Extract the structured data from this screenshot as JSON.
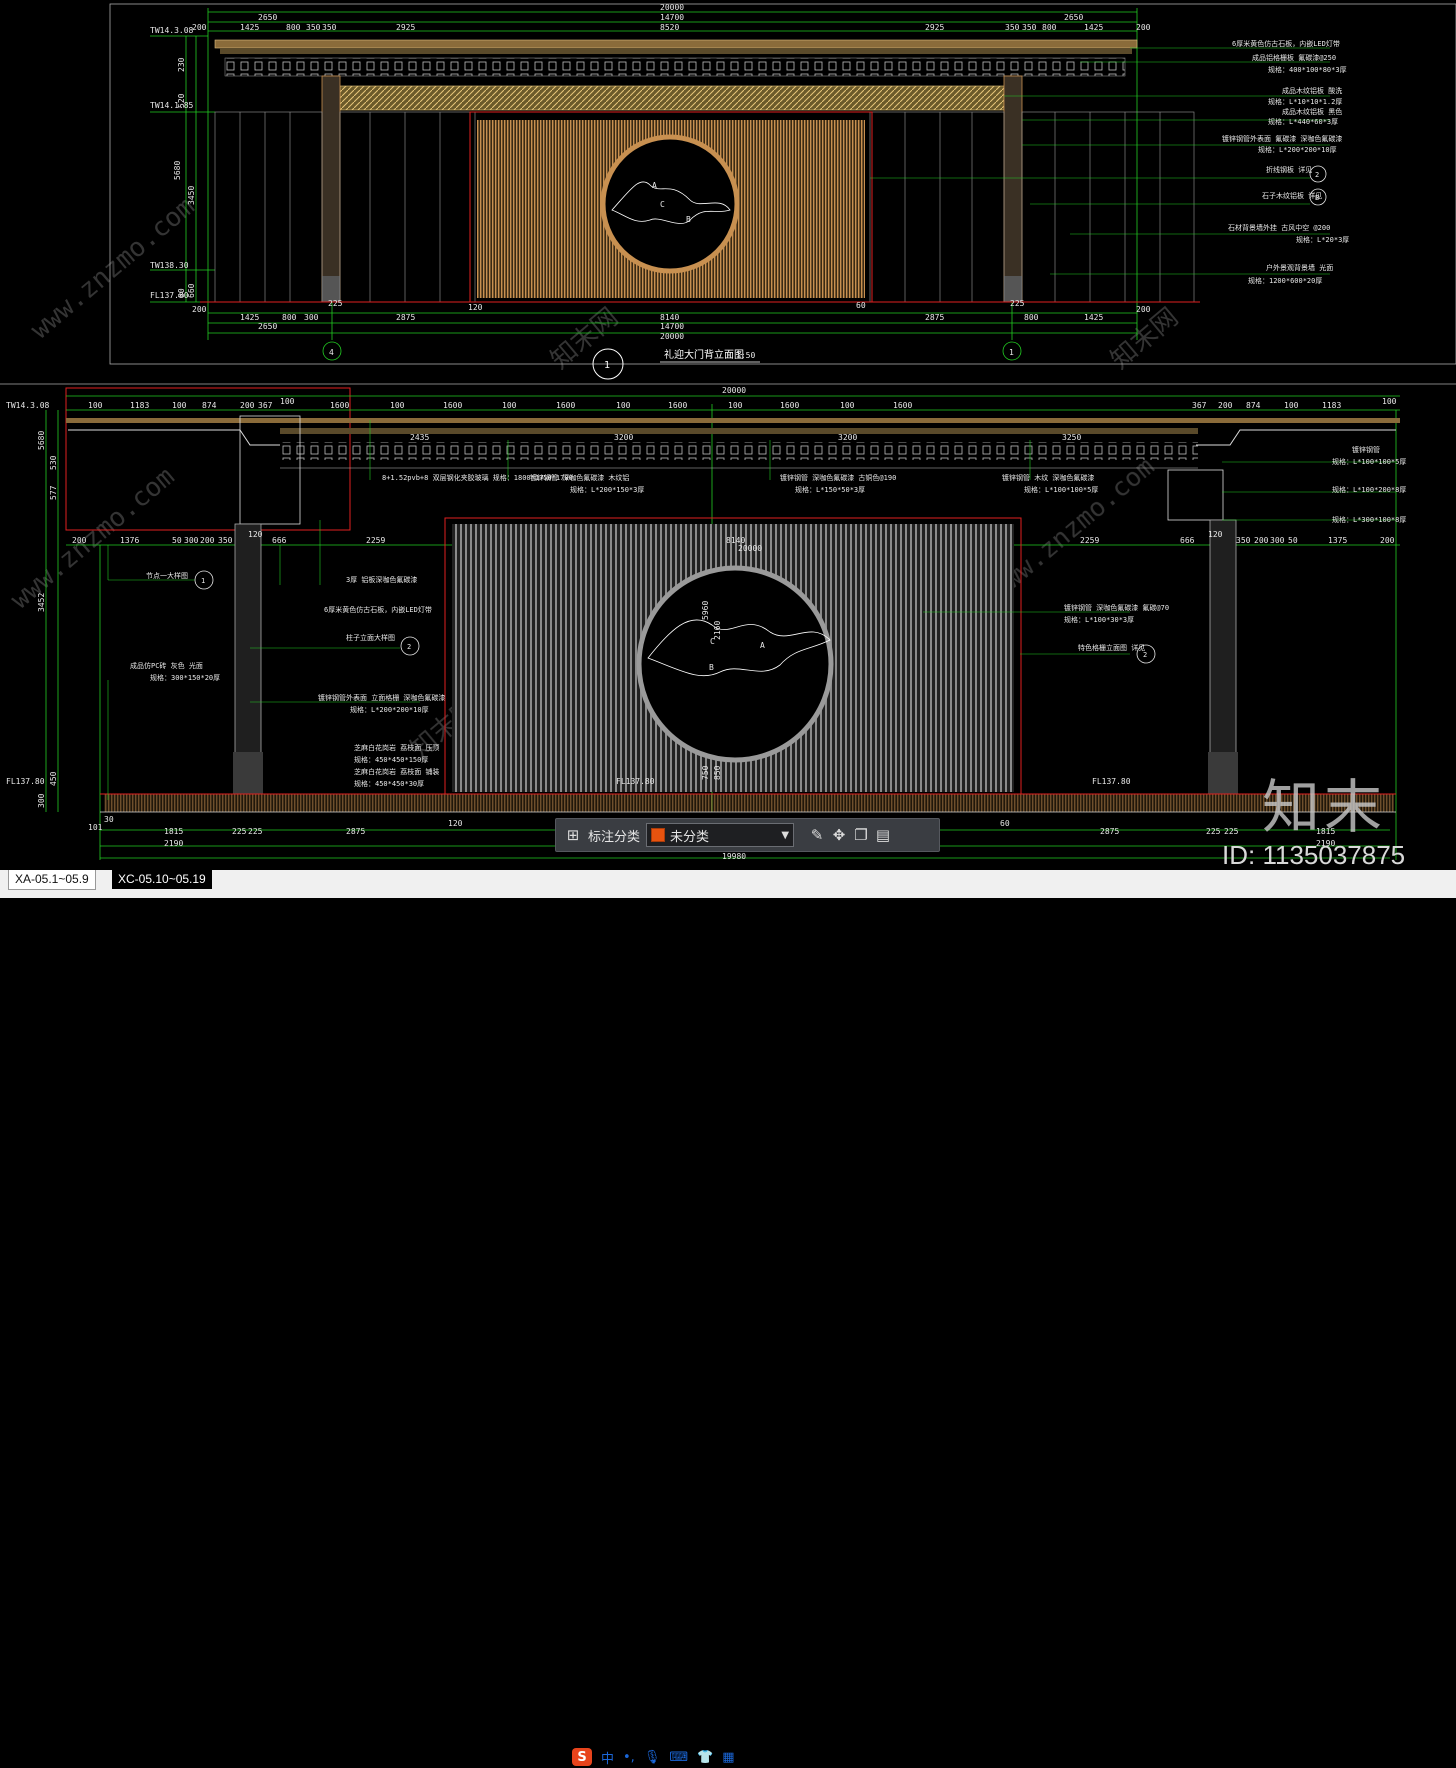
{
  "drawing": {
    "upper_title": "礼迎大门背立面图",
    "upper_scale": "1:50",
    "upper_marker": "1",
    "upper_axis_left": "4",
    "upper_axis_right": "1",
    "upper_dims_top": [
      "20000",
      "14700",
      "2650",
      "1425",
      "800",
      "350",
      "350",
      "2925",
      "8520",
      "2925",
      "350",
      "350",
      "800",
      "1425",
      "2650",
      "200",
      "200"
    ],
    "upper_dims_bottom": [
      "200",
      "1425",
      "800",
      "300",
      "225",
      "2875",
      "120",
      "8140",
      "60",
      "2875",
      "225",
      "800",
      "1425",
      "200",
      "2650",
      "14700",
      "20000"
    ],
    "upper_levels": [
      "TW14.3.08",
      "TW14.1.85",
      "TW138.30",
      "FL137.80"
    ],
    "upper_heights": [
      "230",
      "520",
      "3450",
      "5680",
      "660",
      "80"
    ],
    "upper_notes": [
      "6厚米黄色仿古石板，内嵌LED灯带",
      "成品铝格栅板 氟碳漆@250",
      "规格：400*100*80*3厚",
      "成品木纹铝板 酸洗",
      "规格：L*10*10*1.2厚",
      "成品木纹铝板 黑色",
      "规格：L*440*60*3厚",
      "镀锌钢管外表面 氟碳漆 深咖色氟碳漆",
      "规格：L*200*200*10厚",
      "折线钢板 详见",
      "石子木纹铝板 详见",
      "石材背景墙外挂 古风中空 @200",
      "规格：L*20*3厚",
      "户外景观背景墙 光面",
      "规格：1200*600*20厚"
    ],
    "lower_dims_top": [
      "20000",
      "100",
      "1183",
      "100",
      "874",
      "200",
      "367",
      "100",
      "1600",
      "100",
      "1600",
      "100",
      "1600",
      "100",
      "1600",
      "100",
      "1600",
      "100",
      "1600",
      "367",
      "200",
      "874",
      "100",
      "1183",
      "100"
    ],
    "lower_dims_mid": [
      "200",
      "1376",
      "50",
      "300",
      "200",
      "350",
      "120",
      "666",
      "2259",
      "8140",
      "20000",
      "2259",
      "666",
      "120",
      "350",
      "200",
      "300",
      "50",
      "1375",
      "200"
    ],
    "lower_dims_bottom": [
      "101",
      "30",
      "1815",
      "225",
      "225",
      "2875",
      "120",
      "60",
      "2875",
      "225",
      "225",
      "1815",
      "2190",
      "2190",
      "19980"
    ],
    "lower_dims_beam": [
      "2435",
      "3200",
      "3200",
      "3250"
    ],
    "lower_levels": [
      "TW14.3.08",
      "FL137.80",
      "FL137.80",
      "FL137.80"
    ],
    "lower_heights": [
      "5680",
      "3452",
      "577",
      "530",
      "450",
      "300",
      "2160",
      "5960",
      "750",
      "850"
    ],
    "lower_notes": [
      "8+1.52pvb+8 双层钢化夹胶玻璃 规格：1800*1750*1700",
      "镀锌钢管 深咖色氟碳漆 木纹铝",
      "规格：L*200*150*3厚",
      "镀锌钢管 深咖色氟碳漆 古铜色@190",
      "规格：L*150*50*3厚",
      "镀锌钢管 木纹 深咖色氟碳漆",
      "规格：L*100*100*5厚",
      "镀锌钢管",
      "规格：L*100*100*5厚",
      "规格：L*100*200*8厚",
      "规格：L*300*100*8厚",
      "节点一大样图",
      "3厚 铝板深咖色氟碳漆",
      "6厚米黄色仿古石板，内嵌LED灯带",
      "柱子立面大样图",
      "成品仿PC砖 灰色 光面",
      "规格：300*150*20厚",
      "镀锌钢管外表面 立面格栅 深咖色氟碳漆",
      "规格：L*200*200*10厚",
      "芝麻白花岗岩 荔枝面 压顶",
      "规格：450*450*150厚",
      "芝麻白花岗岩 荔枝面 铺装",
      "规格：450*450*30厚",
      "镀锌钢管 深咖色氟碳漆 氟碳@70",
      "规格：L*100*30*3厚",
      "特色格栅立面图 详见"
    ],
    "circle_labels": [
      "A",
      "B",
      "C"
    ],
    "callouts": [
      "1",
      "2",
      "2",
      "2",
      "B"
    ]
  },
  "annotation_toolbar": {
    "label": "标注分类",
    "selected_value": "未分类",
    "swatch_color": "#e8530f"
  },
  "layout_tabs": [
    {
      "label": "XA-05.1~05.9"
    },
    {
      "label": "XC-05.10~05.19"
    }
  ],
  "ime": {
    "logo": "S",
    "mode": "中"
  },
  "watermark": {
    "brand": "知末",
    "image_id": "ID: 1135037875",
    "faint_cn": "知末网",
    "faint_url": "www.znzmo.com"
  },
  "colors": {
    "background": "#000000",
    "dim_line": "#22cc22",
    "frame_red": "#e02020",
    "wood": "#c89050",
    "grille": "#8a8a8a"
  }
}
